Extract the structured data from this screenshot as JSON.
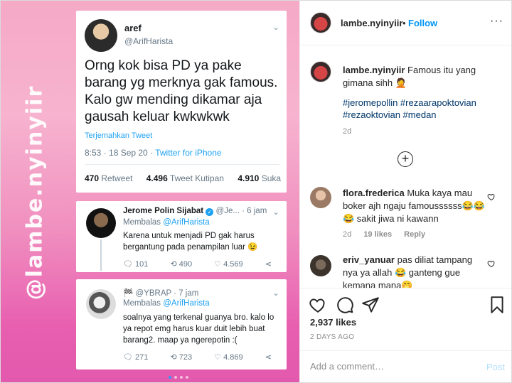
{
  "post_image": {
    "watermark": "@lambe.nyinyiir",
    "tweet1": {
      "name": "aref",
      "handle": "@ArifHarista",
      "text": "Orng kok bisa PD ya pake barang yg merknya gak famous. Kalo gw mending dikamar aja gausah keluar kwkwkwk",
      "translate": "Terjemahkan Tweet",
      "time": "8:53 · 18 Sep 20 · ",
      "source": "Twitter for iPhone",
      "retweets_num": "470",
      "retweets_label": "Retweet",
      "quotes_num": "4.496",
      "quotes_label": "Tweet Kutipan",
      "likes_num": "4.910",
      "likes_label": "Suka"
    },
    "tweet2": {
      "name": "Jerome Polin Sijabat",
      "handle_time": "@Je... · 6 jam",
      "reply_prefix": "Membalas ",
      "reply_handle": "@ArifHarista",
      "text": "Karena untuk menjadi PD gak harus bergantung pada penampilan luar 😉",
      "replies": "101",
      "retweets": "490",
      "likes": "4.569"
    },
    "tweet3": {
      "name": "🏁",
      "handle_time": "@YBRAP · 7 jam",
      "reply_prefix": "Membalas ",
      "reply_handle": "@ArifHarista",
      "text": "soalnya yang terkenal guanya bro. kalo lo ya repot emg harus kuar duit lebih buat barang2. maap ya ngerepotin :(",
      "replies": "271",
      "retweets": "723",
      "likes": "4.869"
    }
  },
  "header": {
    "username": "lambe.nyinyiir",
    "dot": "•",
    "follow": "Follow",
    "more": "···"
  },
  "caption": {
    "username": "lambe.nyinyiir",
    "text": " Famous itu yang gimana sihh 🤦",
    "tags": "#jeromepollin #rezaarapoktovian #rezaoktovian #medan",
    "time": "2d"
  },
  "comments": [
    {
      "username": "flora.frederica",
      "text": " Muka kaya mau boker ajh ngaju famoussssss😂😂 😂 sakit jiwa ni kawann",
      "time": "2d",
      "likes": "19 likes",
      "reply": "Reply"
    },
    {
      "username": "eriv_yanuar",
      "text": " pas diliat tampang nya ya allah 😂 ganteng gue kemana mana🤭",
      "time": "",
      "likes": "",
      "reply": ""
    }
  ],
  "stats": {
    "likes": "2,937 likes",
    "posted": "2 DAYS AGO"
  },
  "add_comment": {
    "placeholder": "Add a comment…",
    "post": "Post"
  }
}
